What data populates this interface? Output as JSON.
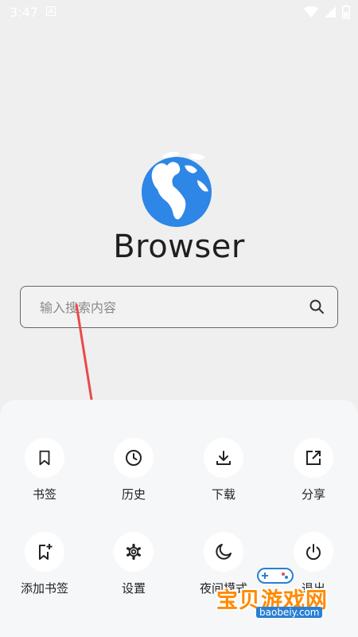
{
  "status_bar": {
    "time": "3:47"
  },
  "app": {
    "title": "Browser"
  },
  "search": {
    "placeholder": "输入搜索内容"
  },
  "menu": {
    "items": [
      {
        "label": "书签",
        "icon": "bookmark-icon"
      },
      {
        "label": "历史",
        "icon": "history-icon"
      },
      {
        "label": "下载",
        "icon": "download-icon"
      },
      {
        "label": "分享",
        "icon": "share-icon"
      },
      {
        "label": "添加书签",
        "icon": "add-bookmark-icon"
      },
      {
        "label": "设置",
        "icon": "settings-icon"
      },
      {
        "label": "夜间模式",
        "icon": "night-mode-icon"
      },
      {
        "label": "退出",
        "icon": "power-icon"
      }
    ]
  },
  "watermark": {
    "text": "宝贝游戏网",
    "url": "baobeiy.com"
  },
  "colors": {
    "globe_blue": "#2e86e6",
    "arrow_red": "#e84a4a",
    "sheet_bg": "#f6f7f9"
  }
}
